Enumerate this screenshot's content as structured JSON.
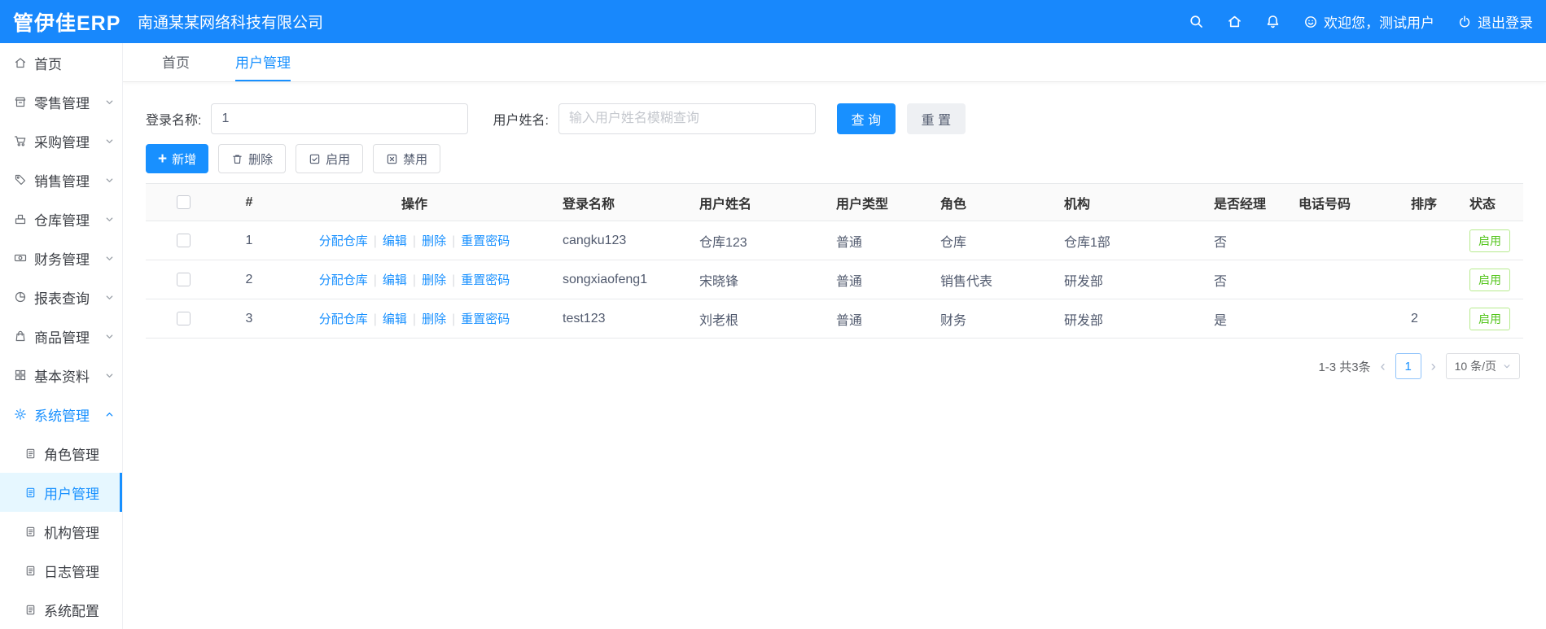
{
  "colors": {
    "accent": "#1890ff",
    "success": "#52c41a",
    "header_bg": "#1888fc",
    "active_bg": "#e6f7ff"
  },
  "header": {
    "logo": "管伊佳ERP",
    "company": "南通某某网络科技有限公司",
    "welcome": "欢迎您，测试用户",
    "logout": "退出登录"
  },
  "sidebar": {
    "items": [
      {
        "label": "首页",
        "icon": "home-icon"
      },
      {
        "label": "零售管理",
        "icon": "retail-icon"
      },
      {
        "label": "采购管理",
        "icon": "purchase-icon"
      },
      {
        "label": "销售管理",
        "icon": "sales-icon"
      },
      {
        "label": "仓库管理",
        "icon": "warehouse-icon"
      },
      {
        "label": "财务管理",
        "icon": "finance-icon"
      },
      {
        "label": "报表查询",
        "icon": "report-icon"
      },
      {
        "label": "商品管理",
        "icon": "goods-icon"
      },
      {
        "label": "基本资料",
        "icon": "basic-data-icon"
      },
      {
        "label": "系统管理",
        "icon": "gear-icon"
      }
    ],
    "submenu": [
      {
        "label": "角色管理",
        "icon": "doc-icon"
      },
      {
        "label": "用户管理",
        "icon": "doc-icon"
      },
      {
        "label": "机构管理",
        "icon": "doc-icon"
      },
      {
        "label": "日志管理",
        "icon": "doc-icon"
      },
      {
        "label": "系统配置",
        "icon": "doc-icon"
      }
    ]
  },
  "tabs": [
    {
      "label": "首页"
    },
    {
      "label": "用户管理",
      "active": true
    }
  ],
  "search": {
    "login_label": "登录名称:",
    "login_value": "1",
    "name_label": "用户姓名:",
    "name_placeholder": "输入用户姓名模糊查询",
    "query": "查 询",
    "reset": "重 置"
  },
  "toolbar": {
    "add": "新增",
    "delete": "删除",
    "enable": "启用",
    "disable": "禁用"
  },
  "table": {
    "headers": [
      "#",
      "操作",
      "登录名称",
      "用户姓名",
      "用户类型",
      "角色",
      "机构",
      "是否经理",
      "电话号码",
      "排序",
      "状态"
    ],
    "actions": [
      "分配仓库",
      "编辑",
      "删除",
      "重置密码"
    ],
    "rows": [
      {
        "index": "1",
        "login": "cangku123",
        "name": "仓库123",
        "type": "普通",
        "role": "仓库",
        "org": "仓库1部",
        "manager": "否",
        "phone": "",
        "sort": "",
        "status": "启用"
      },
      {
        "index": "2",
        "login": "songxiaofeng1",
        "name": "宋晓锋",
        "type": "普通",
        "role": "销售代表",
        "org": "研发部",
        "manager": "否",
        "phone": "",
        "sort": "",
        "status": "启用"
      },
      {
        "index": "3",
        "login": "test123",
        "name": "刘老根",
        "type": "普通",
        "role": "财务",
        "org": "研发部",
        "manager": "是",
        "phone": "",
        "sort": "2",
        "status": "启用"
      }
    ]
  },
  "pagination": {
    "total": "1-3 共3条",
    "prev": "‹",
    "page": "1",
    "next": "›",
    "page_size": "10 条/页"
  }
}
